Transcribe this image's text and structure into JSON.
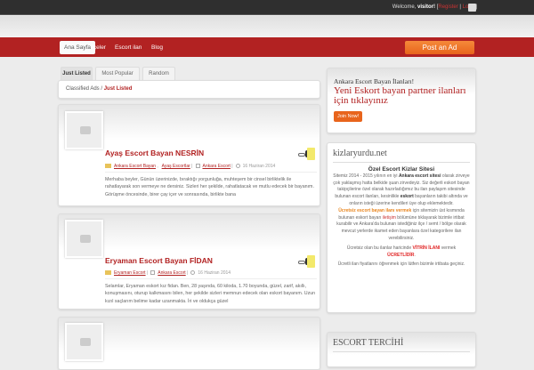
{
  "topbar": {
    "welcome": "Welcome,",
    "user": "visitor!",
    "register": "Register",
    "login": "Login",
    "rss_icon": "rss-icon"
  },
  "nav": {
    "items": [
      "Ana Sayfa",
      "ilçeler",
      "Escort ilan",
      "Blog"
    ],
    "post_ad": "Post an Ad"
  },
  "tabs": [
    "Just Listed",
    "Most Popular",
    "Random"
  ],
  "breadcrumb": {
    "root": "Classified Ads",
    "sep": " / ",
    "current": "Just Listed"
  },
  "listings": [
    {
      "title": "Ayaş Escort Bayan NESRİN",
      "cat1": "Ankara Escort Bayan",
      "cat2": "Ayaş Escortlar",
      "author": "Ankara Escort",
      "date": "16 Haziran 2014",
      "desc": "Merhaba beyler, Günün üzerinizde, bıraktığı yorgunluğa, muhteşem bir cinsel birliktelik ile rahatlayarak son vermeye ne dersiniz. Sizleri her şekilde, rahatlatacak ve mutlu edecek bir bayanım. Görüşme öncesinde, birer çay içer ve sonrasında, birlikte bana"
    },
    {
      "title": "Eryaman Escort Bayan FİDAN",
      "cat1": "Eryaman Escort",
      "author": "Ankara Escort",
      "date": "16 Haziran 2014",
      "desc": "Selamlar, Eryaman eskort kız fidan. Ben, 28 yaşında, 60 kiloda, 1.70 boyunda, güzel, zarif, akıllı, konuşmasını, oturup kalkmasını bilen, her şekilde sizleri memnun edecek olan eskort bayanım. Uzun kızıl saçlarım belime kadar uzanmakta. İri ve oldukça güzel"
    }
  ],
  "promo": {
    "heading": "Ankara Escort Bayan İlanları!",
    "tagline": "Yeni Eskort bayan partner ilanları için tıklayınız",
    "join": "Join Now!"
  },
  "info": {
    "site": "kizlaryurdu.net",
    "title": "Özel Escort Kizlar Sitesi",
    "p1a": "Sitemiz 2014 - 2015 yılının en iyi ",
    "p1b": "Ankara escort sitesi",
    "p1c": " olarak zirveye çok yaklaşmış hatta belkide şuan zirvedeyiz. Siz değerli eskort bayan takipçilerine özel olarak hazırladığımız bu ilan paylaşım sitesinde bulunan escort ilanları, kesinlikle ",
    "p1d": "eskort",
    "p1e": " bayanların takibi altında ve onların isteği üzerine kendileri üye olup eklemektedir.",
    "p2a": "Ücretsiz escort bayan ilanı vermek",
    "p2b": " için sitemizin üst kısmında bulunan eskort bayan ",
    "p2c": "iletişim",
    "p2d": " bölümüne tıklayarak bizimle irtibat kurabilir ve Ankara'da bulunan istediğiniz ilçe / semt / bölge olarak mevcut yerlerde ikamet eden bayanlara özel kategorilere ilan verebilirsiniz.",
    "p3a": "Ücretsiz olan bu ilanlar haricinde ",
    "p3b": "VİTRİN İLANI",
    "p3c": " vermek ",
    "p3d": "ÜCRETLİDİR",
    "p4": "Ücretli ilan fiyatlarını öğrenmek için lütfen bizimle irtibata geçiniz."
  },
  "preference": {
    "title": "ESCORT TERCİHİ"
  },
  "colors": {
    "brand": "#b22222",
    "accent": "#e8641c",
    "topbar": "#2f2f2f"
  }
}
